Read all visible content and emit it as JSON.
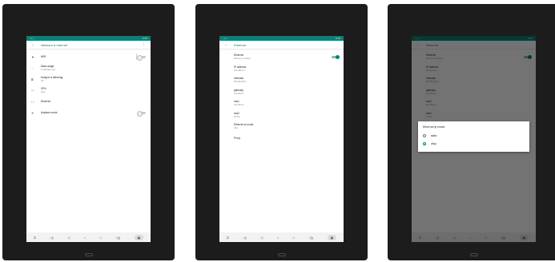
{
  "colors": {
    "accent": "#0e7e74",
    "bezel": "#1c1c1c"
  },
  "status": {
    "time": "10:36"
  },
  "screen1": {
    "title": "Network & Internet",
    "items": [
      {
        "icon": "wifi-icon",
        "title": "WiFi",
        "subtitle": ""
      },
      {
        "icon": "data-usage-icon",
        "title": "Data usage",
        "subtitle": "0.0 kB data used"
      },
      {
        "icon": "hotspot-icon",
        "title": "Hotspot & tethering",
        "subtitle": "Off"
      },
      {
        "icon": "vpn-icon",
        "title": "VPN",
        "subtitle": "None"
      },
      {
        "icon": "ethernet-icon",
        "title": "Ethernet",
        "subtitle": ""
      },
      {
        "icon": "airplane-icon",
        "title": "Airplane mode",
        "subtitle": ""
      }
    ]
  },
  "screen2": {
    "title": "Ethernet",
    "items": [
      {
        "title": "Ethernet",
        "subtitle": "Ethernet is enabled"
      },
      {
        "title": "IP address",
        "subtitle": "192.168.0.27"
      },
      {
        "title": "netmask",
        "subtitle": "255.255.255.0"
      },
      {
        "title": "gateway",
        "subtitle": "192.168.0.1"
      },
      {
        "title": "dns1",
        "subtitle": "192.168.0.1"
      },
      {
        "title": "dns2",
        "subtitle": "8.8.8.8"
      },
      {
        "title": "Ethernet ip mode",
        "subtitle": "dhcp"
      },
      {
        "title": "Proxy",
        "subtitle": ""
      }
    ]
  },
  "dialog": {
    "title": "Ethernet ip mode",
    "options": [
      {
        "label": "static",
        "selected": false
      },
      {
        "label": "dhcp",
        "selected": true
      }
    ]
  }
}
